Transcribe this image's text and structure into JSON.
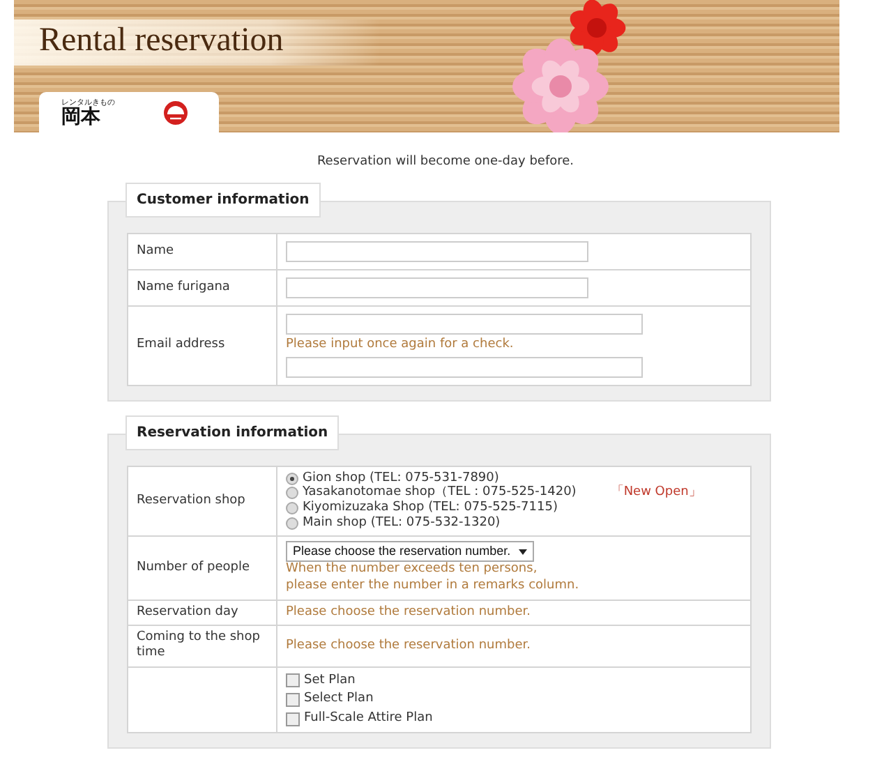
{
  "banner": {
    "title": "Rental reservation",
    "logo": {
      "tagline": "レンタルきもの",
      "name": "岡本"
    }
  },
  "notice": "Reservation will become one-day before.",
  "customer": {
    "legend": "Customer information",
    "rows": [
      {
        "label": "Name",
        "kind": "text"
      },
      {
        "label": "Name furigana",
        "kind": "text"
      },
      {
        "label": "Email address",
        "kind": "email",
        "hint": "Please input once again for a check."
      }
    ]
  },
  "reservation": {
    "legend": "Reservation information",
    "rows": [
      {
        "label": "Reservation shop",
        "kind": "radio",
        "options": [
          {
            "label": "Gion shop (TEL: 075-531-7890)",
            "selected": true
          },
          {
            "label": "Yasakanotomae shop（TEL : 075-525-1420)",
            "selected": false,
            "badge": "「New Open」"
          },
          {
            "label": "Kiyomizuzaka Shop (TEL: 075-525-7115)",
            "selected": false
          },
          {
            "label": "Main shop (TEL: 075-532-1320)",
            "selected": false
          }
        ]
      },
      {
        "label": "Number of people",
        "kind": "select",
        "value": "Please choose the reservation number.",
        "hint": "When the number exceeds ten persons,\nplease enter the number in a remarks column."
      },
      {
        "label": "Reservation day",
        "kind": "note",
        "hint": "Please choose the reservation number."
      },
      {
        "label": "Coming to the shop time",
        "kind": "note",
        "hint": "Please choose the reservation number."
      },
      {
        "kind": "checkbox",
        "options": [
          {
            "label": "Set Plan",
            "checked": false
          },
          {
            "label": "Select Plan",
            "checked": false
          },
          {
            "label": "Full-Scale Attire Plan",
            "checked": false
          }
        ]
      }
    ]
  }
}
